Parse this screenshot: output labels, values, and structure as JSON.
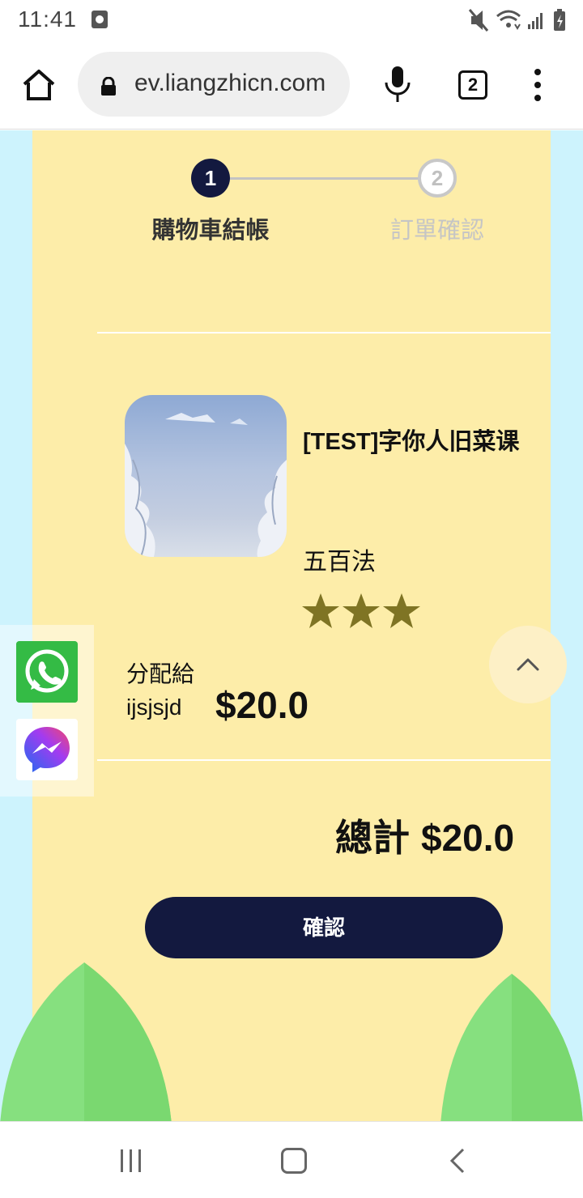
{
  "status_bar": {
    "time": "11:41",
    "icons": [
      "app-notification-icon",
      "mute-icon",
      "wifi-icon",
      "signal-icon",
      "battery-icon"
    ]
  },
  "browser": {
    "url": "ev.liangzhicn.com",
    "tab_count": "2",
    "icons": [
      "home-icon",
      "lock-icon",
      "mic-icon",
      "tabs-icon",
      "more-menu-icon"
    ]
  },
  "steps": [
    {
      "number": "1",
      "label": "購物車結帳",
      "active": true
    },
    {
      "number": "2",
      "label": "訂單確認",
      "active": false
    }
  ],
  "cart_item": {
    "name": "[TEST]字你人旧菜课",
    "subtitle": "五百法",
    "rating": 3,
    "assign_label": "分配給",
    "assignee": "ijsjsjd",
    "price": "$20.0"
  },
  "summary": {
    "total_label": "總計",
    "total_value": "$20.0"
  },
  "actions": {
    "confirm_label": "確認"
  },
  "social": [
    "whatsapp-icon",
    "messenger-icon"
  ],
  "colors": {
    "page_bg": "#cdf3fd",
    "card_bg": "#fdeda9",
    "primary_dark": "#13193f",
    "star": "#7f7424",
    "leaf": "#7ad870"
  }
}
